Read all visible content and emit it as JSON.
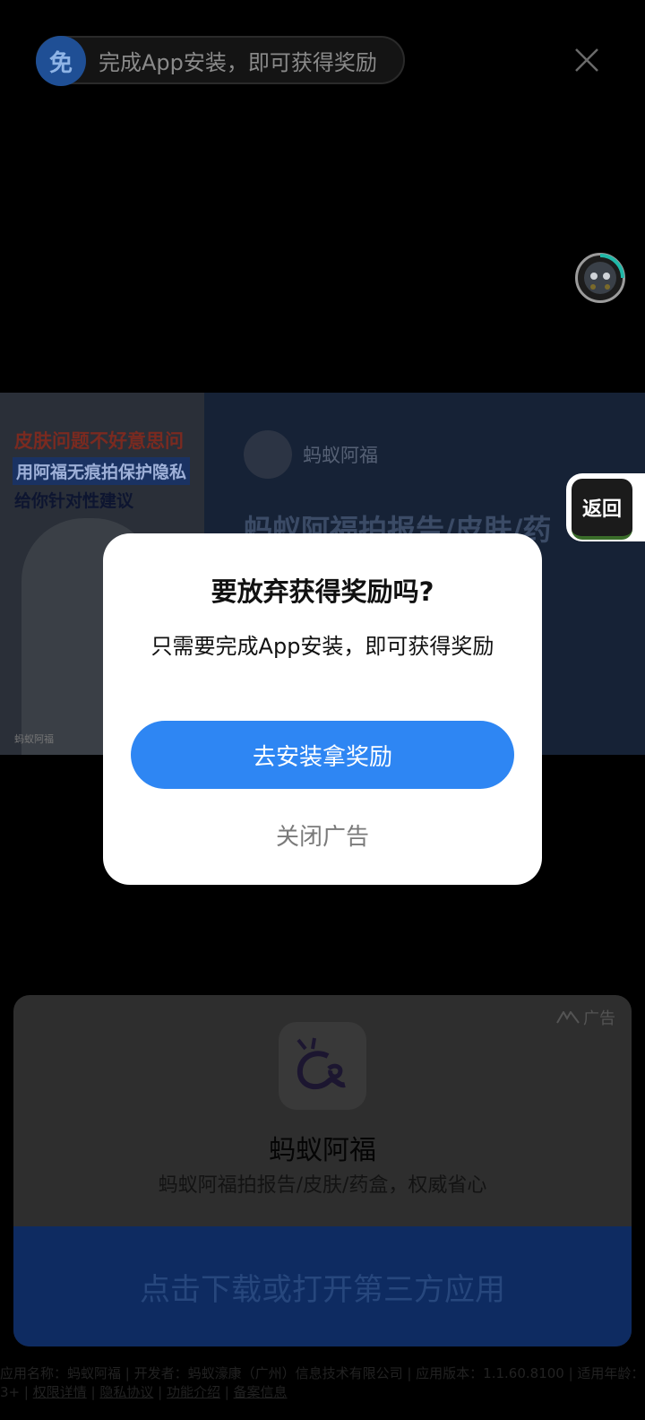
{
  "top_banner": {
    "badge": "免",
    "text": "完成App安装，即可获得奖励"
  },
  "icons": {
    "close": "close-icon",
    "avatar": "avatar-icon",
    "app_logo": "app-logo-icon",
    "ad_mark": "ad-mark-icon"
  },
  "ad_creative": {
    "left_line1": "皮肤问题不好意思问",
    "left_line2": "用阿福无痕拍保护隐私",
    "left_line3": "给你针对性建议",
    "left_footer": "蚂蚁阿福",
    "brand_name": "蚂蚁阿福",
    "headline": "蚂蚁阿福拍报告/皮肤/药"
  },
  "back_button": {
    "label": "返回"
  },
  "modal": {
    "title": "要放弃获得奖励吗?",
    "body": "只需要完成App安装，即可获得奖励",
    "primary_label": "去安装拿奖励",
    "secondary_label": "关闭广告"
  },
  "app_card": {
    "ad_label": "广告",
    "app_name": "蚂蚁阿福",
    "app_desc": "蚂蚁阿福拍报告/皮肤/药盒，权威省心",
    "download_label": "点击下载或打开第三方应用"
  },
  "footer": {
    "info": "应用名称：蚂蚁阿福 | 开发者：蚂蚁濠康（广州）信息技术有限公司 | 应用版本：1.1.60.8100 | 适用年龄：3+ |",
    "links": [
      "权限详情",
      "隐私协议",
      "功能介绍",
      "备案信息"
    ]
  },
  "colors": {
    "primary_blue": "#2e86f3",
    "download_blue": "#0e2b61",
    "modal_bg": "#ffffff"
  }
}
